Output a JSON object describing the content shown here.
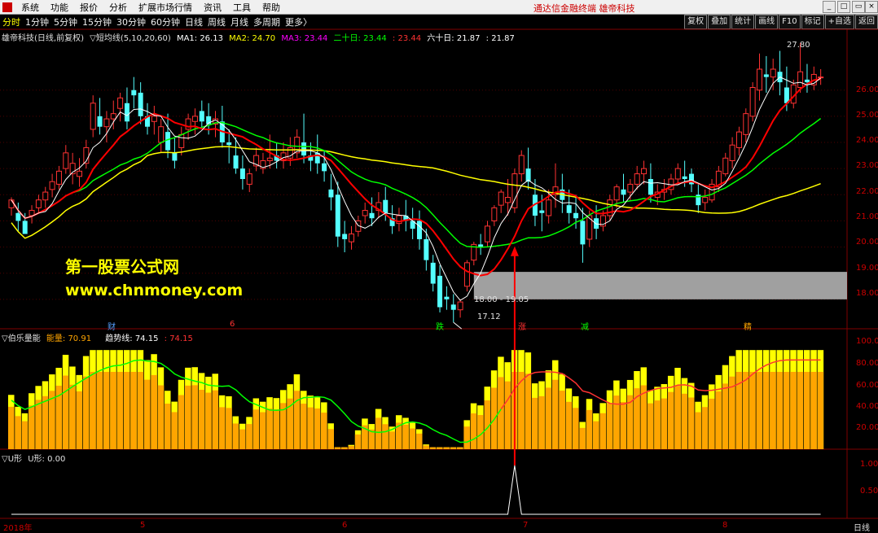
{
  "menu": {
    "items": [
      "系统",
      "功能",
      "报价",
      "分析",
      "扩展市场行情",
      "资讯",
      "工具",
      "帮助"
    ],
    "center_text": "通达信金融终端  雄帝科技"
  },
  "tabs": {
    "items": [
      "分时",
      "1分钟",
      "5分钟",
      "15分钟",
      "30分钟",
      "60分钟",
      "日线",
      "周线",
      "月线",
      "多周期",
      "更多〉"
    ],
    "active": "分时"
  },
  "right_buttons": [
    "复权",
    "叠加",
    "统计",
    "画线",
    "F10",
    "标记",
    "+自选",
    "返回"
  ],
  "main_legend": {
    "title": "雄帝科技(日线,前复权)",
    "indicator": "▽短均线(5,10,20,60)",
    "ma1": "MA1: 26.13",
    "ma2": "MA2: 24.70",
    "ma3": "MA3: 23.44",
    "ma3b": "二十日: 23.44",
    "ma3c": ": 23.44",
    "ma4": "六十日: 21.87",
    "ma4b": ": 21.87"
  },
  "price_axis": [
    "26.00",
    "25.00",
    "24.00",
    "23.00",
    "22.00",
    "21.00",
    "20.00",
    "19.00",
    "18.00"
  ],
  "annotations": {
    "high": "27.80",
    "low": "17.12",
    "range": "18.00 - 19.05"
  },
  "markers": [
    "财",
    "6",
    "跌",
    "涨",
    "减",
    "精"
  ],
  "watermark": {
    "line1": "第一股票公式网",
    "line2": "www.chnmoney.com"
  },
  "sub1_legend": {
    "name": "▽伯乐量能",
    "energy": "能量: 70.91",
    "trend": "趋势线: 74.15",
    "trend2": ": 74.15"
  },
  "sub1_axis": [
    "100.0",
    "80.00",
    "60.00",
    "40.00",
    "20.00"
  ],
  "sub2_legend": {
    "name": "▽U形",
    "value": "U形: 0.00"
  },
  "sub2_axis": [
    "1.00",
    "0.50"
  ],
  "date_axis": [
    "2018年",
    "5",
    "6",
    "7",
    "8"
  ],
  "date_axis_right": "日线",
  "colors": {
    "up": "#ff3232",
    "down": "#54ffff",
    "ma1": "#ffffff",
    "ma2": "#ff0000",
    "ma3": "#00ff00",
    "ma4": "#ffff00",
    "bar_a": "#ffa500",
    "bar_b": "#ffff00",
    "zone": "#a0a0a0"
  },
  "chart_data": {
    "type": "candlestick",
    "title": "雄帝科技(日线,前复权)",
    "ylim": [
      17.0,
      28.2
    ],
    "candles": [
      [
        21.5,
        21.9,
        21.8,
        21.2
      ],
      [
        21.3,
        21.7,
        21.0,
        20.6
      ],
      [
        21.0,
        21.3,
        20.5,
        20.6
      ],
      [
        21.2,
        21.6,
        21.4,
        20.9
      ],
      [
        21.5,
        22.0,
        21.8,
        21.3
      ],
      [
        21.8,
        22.3,
        22.1,
        21.5
      ],
      [
        22.2,
        22.8,
        22.5,
        21.9
      ],
      [
        22.4,
        23.1,
        22.9,
        22.2
      ],
      [
        23.0,
        23.9,
        23.6,
        22.8
      ],
      [
        22.8,
        23.6,
        23.2,
        22.4
      ],
      [
        22.7,
        23.4,
        22.9,
        22.3
      ],
      [
        23.2,
        24.1,
        23.8,
        23.0
      ],
      [
        24.5,
        25.8,
        25.5,
        24.2
      ],
      [
        25.0,
        25.7,
        24.6,
        24.3
      ],
      [
        24.6,
        25.2,
        24.9,
        24.0
      ],
      [
        24.9,
        25.6,
        25.1,
        24.5
      ],
      [
        25.3,
        25.9,
        25.7,
        24.8
      ],
      [
        25.5,
        26.1,
        24.8,
        24.5
      ],
      [
        26.0,
        26.5,
        25.8,
        25.3
      ],
      [
        25.9,
        26.3,
        25.0,
        24.7
      ],
      [
        25.0,
        25.5,
        24.6,
        24.3
      ],
      [
        24.8,
        25.4,
        25.0,
        24.3
      ],
      [
        24.0,
        24.9,
        24.6,
        23.6
      ],
      [
        24.4,
        25.1,
        23.7,
        23.4
      ],
      [
        23.6,
        24.2,
        23.3,
        23.0
      ],
      [
        23.8,
        24.6,
        24.3,
        23.5
      ],
      [
        24.5,
        25.1,
        24.9,
        24.1
      ],
      [
        24.8,
        25.3,
        25.0,
        24.3
      ],
      [
        25.2,
        25.6,
        24.8,
        24.5
      ],
      [
        25.0,
        25.5,
        24.7,
        24.3
      ],
      [
        24.7,
        25.2,
        24.9,
        24.2
      ],
      [
        24.8,
        25.4,
        24.0,
        23.8
      ],
      [
        24.0,
        24.5,
        23.9,
        23.2
      ],
      [
        23.5,
        24.2,
        23.0,
        22.8
      ],
      [
        23.0,
        23.5,
        22.6,
        22.2
      ],
      [
        22.4,
        23.0,
        22.8,
        22.1
      ],
      [
        23.1,
        23.8,
        23.5,
        22.9
      ],
      [
        23.0,
        23.6,
        23.3,
        22.8
      ],
      [
        23.3,
        24.3,
        23.4,
        23.0
      ],
      [
        23.5,
        24.0,
        23.3,
        23.0
      ],
      [
        23.3,
        24.0,
        23.6,
        23.0
      ],
      [
        23.4,
        24.2,
        23.8,
        23.1
      ],
      [
        23.6,
        24.5,
        24.2,
        23.4
      ],
      [
        24.0,
        25.1,
        23.5,
        23.2
      ],
      [
        23.5,
        24.0,
        23.3,
        22.9
      ],
      [
        23.6,
        24.3,
        23.2,
        22.8
      ],
      [
        23.2,
        23.7,
        22.9,
        22.5
      ],
      [
        22.2,
        22.8,
        21.9,
        21.4
      ],
      [
        22.0,
        22.5,
        20.4,
        20.0
      ],
      [
        20.5,
        21.0,
        20.3,
        19.8
      ],
      [
        20.2,
        20.8,
        20.5,
        19.9
      ],
      [
        20.6,
        21.2,
        21.0,
        20.4
      ],
      [
        21.2,
        21.7,
        21.4,
        20.9
      ],
      [
        21.3,
        21.9,
        21.1,
        20.8
      ],
      [
        21.4,
        22.1,
        21.7,
        21.1
      ],
      [
        21.8,
        22.3,
        21.3,
        21.0
      ],
      [
        21.1,
        21.6,
        20.8,
        20.5
      ],
      [
        20.9,
        21.5,
        21.2,
        20.6
      ],
      [
        21.2,
        21.8,
        21.0,
        20.6
      ],
      [
        21.0,
        21.5,
        20.7,
        20.3
      ],
      [
        21.0,
        21.4,
        20.3,
        19.9
      ],
      [
        20.3,
        20.7,
        19.5,
        19.1
      ],
      [
        19.4,
        19.7,
        18.6,
        18.3
      ],
      [
        18.9,
        19.3,
        17.7,
        17.5
      ],
      [
        18.1,
        18.5,
        18.0,
        17.6
      ],
      [
        17.8,
        18.2,
        17.6,
        17.12
      ],
      [
        17.6,
        18.0,
        17.9,
        17.3
      ],
      [
        18.5,
        19.5,
        19.4,
        18.3
      ],
      [
        19.5,
        20.2,
        20.1,
        19.3
      ],
      [
        20.1,
        20.5,
        20.0,
        19.7
      ],
      [
        20.2,
        21.0,
        20.8,
        20.0
      ],
      [
        21.0,
        21.6,
        21.5,
        20.8
      ],
      [
        21.6,
        22.2,
        22.1,
        21.3
      ],
      [
        21.7,
        22.6,
        21.9,
        21.2
      ],
      [
        21.5,
        23.0,
        22.8,
        21.3
      ],
      [
        22.8,
        23.7,
        23.5,
        22.5
      ],
      [
        23.0,
        23.8,
        22.5,
        22.2
      ],
      [
        22.0,
        22.6,
        21.2,
        20.8
      ],
      [
        21.4,
        22.0,
        21.3,
        20.6
      ],
      [
        21.2,
        22.2,
        21.8,
        20.9
      ],
      [
        22.0,
        23.2,
        22.3,
        21.5
      ],
      [
        22.2,
        22.8,
        21.8,
        21.3
      ],
      [
        21.6,
        22.2,
        21.3,
        20.9
      ],
      [
        21.3,
        22.0,
        21.1,
        20.7
      ],
      [
        21.0,
        21.5,
        20.1,
        19.4
      ],
      [
        20.3,
        21.4,
        21.2,
        20.0
      ],
      [
        21.1,
        21.6,
        20.7,
        20.3
      ],
      [
        20.8,
        21.4,
        21.2,
        20.6
      ],
      [
        21.2,
        22.0,
        21.8,
        21.0
      ],
      [
        21.8,
        22.4,
        22.3,
        21.5
      ],
      [
        22.2,
        22.8,
        22.0,
        21.7
      ],
      [
        22.1,
        22.6,
        22.4,
        21.8
      ],
      [
        22.4,
        23.1,
        22.8,
        22.2
      ],
      [
        22.8,
        23.3,
        23.0,
        22.4
      ],
      [
        22.6,
        23.2,
        22.0,
        21.7
      ],
      [
        21.9,
        22.4,
        22.1,
        21.6
      ],
      [
        22.1,
        22.6,
        22.2,
        21.8
      ],
      [
        22.2,
        22.8,
        22.6,
        22.0
      ],
      [
        22.6,
        23.2,
        23.0,
        22.4
      ],
      [
        22.7,
        23.3,
        22.6,
        22.3
      ],
      [
        22.8,
        23.0,
        22.4,
        22.1
      ],
      [
        22.0,
        22.4,
        21.6,
        21.3
      ],
      [
        21.7,
        22.2,
        21.9,
        21.4
      ],
      [
        21.8,
        22.6,
        22.4,
        21.7
      ],
      [
        22.3,
        23.1,
        22.9,
        22.1
      ],
      [
        22.8,
        23.6,
        23.4,
        22.7
      ],
      [
        23.3,
        24.2,
        23.9,
        23.0
      ],
      [
        23.8,
        24.6,
        24.4,
        23.5
      ],
      [
        24.3,
        25.3,
        25.1,
        24.0
      ],
      [
        25.0,
        26.3,
        26.1,
        24.8
      ],
      [
        26.0,
        27.4,
        26.8,
        25.6
      ],
      [
        26.6,
        27.3,
        26.5,
        25.9
      ],
      [
        26.5,
        27.2,
        26.8,
        26.0
      ],
      [
        26.7,
        27.5,
        26.3,
        25.8
      ],
      [
        26.1,
        26.9,
        25.5,
        25.2
      ],
      [
        25.5,
        26.4,
        26.2,
        25.3
      ],
      [
        26.1,
        27.8,
        26.7,
        25.9
      ],
      [
        26.4,
        27.0,
        26.3,
        25.9
      ],
      [
        26.2,
        26.9,
        26.6,
        26.0
      ],
      [
        26.5,
        26.8,
        26.5,
        26.2
      ]
    ],
    "sub1": {
      "type": "bar",
      "name": "伯乐量能",
      "ylim": [
        0,
        110
      ]
    },
    "sub2": {
      "type": "line",
      "name": "U形",
      "ylim": [
        0,
        1.2
      ],
      "peak_index": 74,
      "peak_value": 1.0
    }
  }
}
